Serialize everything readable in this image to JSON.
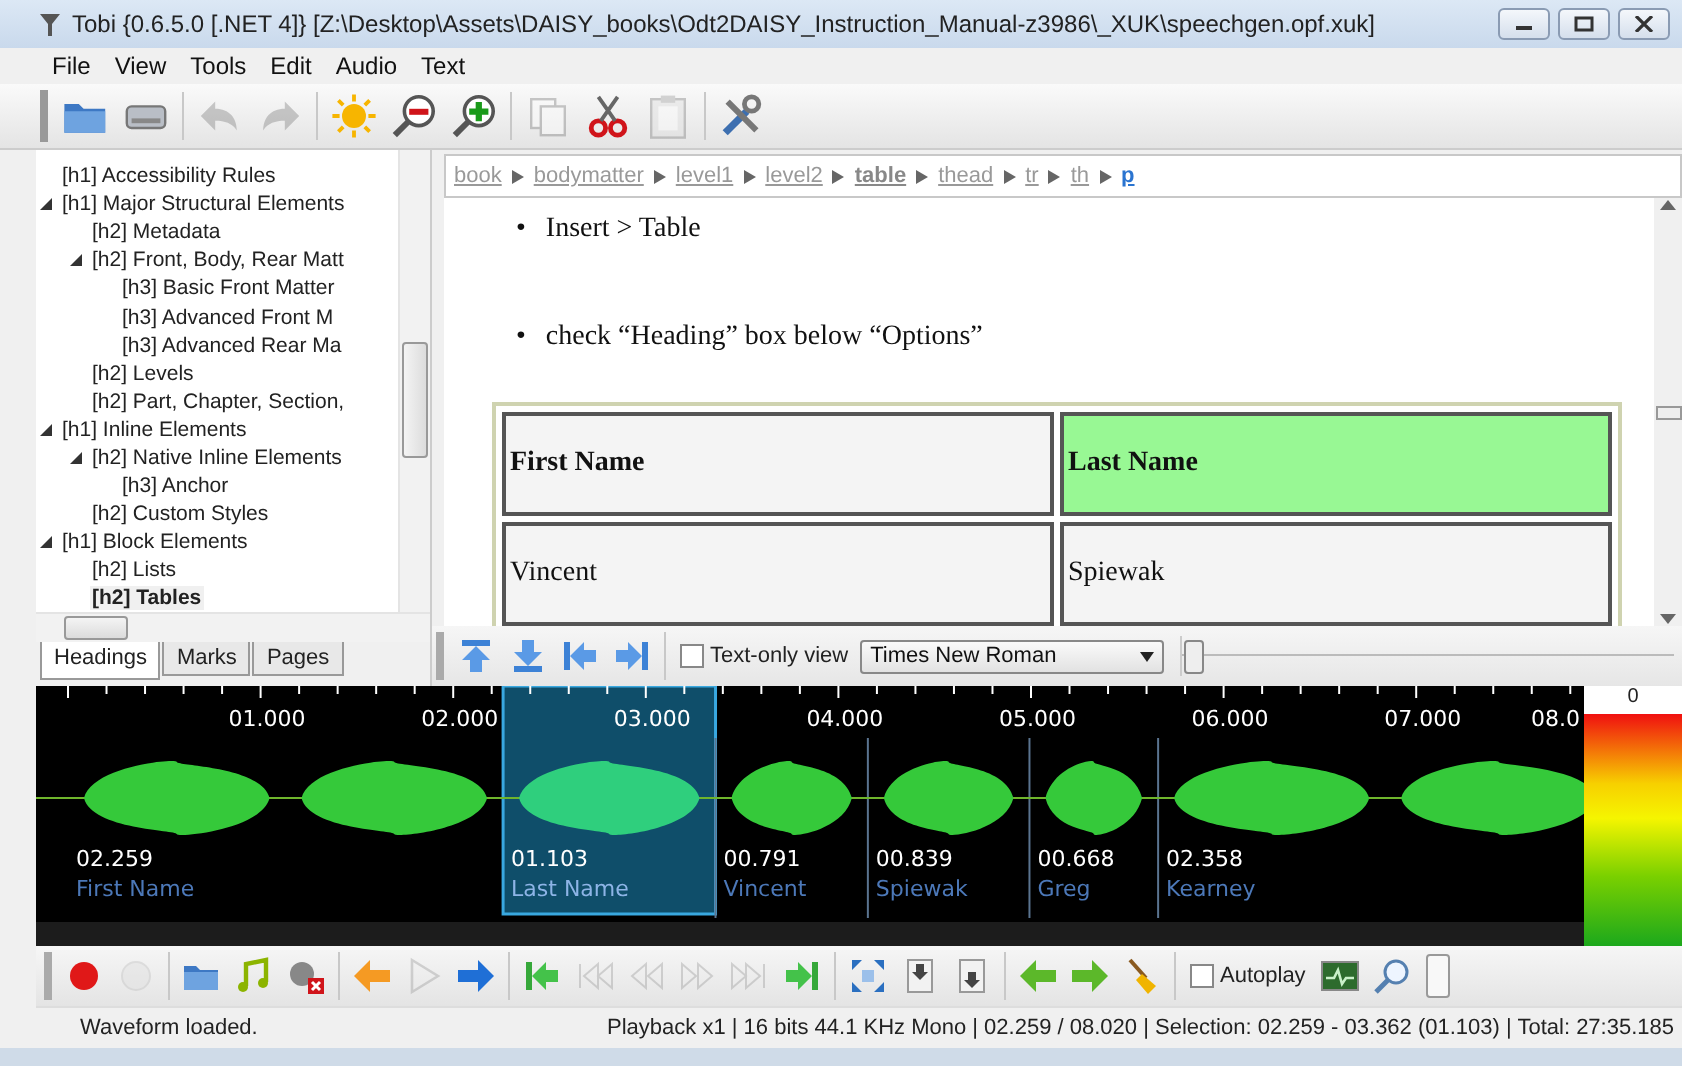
{
  "window": {
    "title": "Tobi {0.6.5.0 [.NET 4]} [Z:\\Desktop\\Assets\\DAISY_books\\Odt2DAISY_Instruction_Manual-z3986\\_XUK\\speechgen.opf.xuk]"
  },
  "menu": [
    "File",
    "View",
    "Tools",
    "Edit",
    "Audio",
    "Text"
  ],
  "toolbar": [
    {
      "disabled": false
    },
    {
      "disabled": false
    },
    {
      "disabled": true
    },
    {
      "disabled": true
    },
    {
      "disabled": false
    },
    {
      "disabled": false
    },
    {
      "disabled": false
    },
    {
      "disabled": true
    },
    {
      "disabled": false
    },
    {
      "disabled": true
    },
    {
      "disabled": false
    }
  ],
  "tree": [
    {
      "label": "[h1] Accessibility Rules",
      "selected": false
    },
    {
      "label": "[h1] Major Structural Elements",
      "selected": false,
      "expanded": true,
      "children": [
        {
          "label": "[h2] Metadata",
          "selected": false
        },
        {
          "label": "[h2] Front, Body, Rear Matt",
          "selected": false,
          "expanded": true,
          "children": [
            {
              "label": "[h3] Basic Front Matter",
              "selected": false
            },
            {
              "label": "[h3] Advanced Front M",
              "selected": false
            },
            {
              "label": "[h3] Advanced Rear Ma",
              "selected": false
            }
          ]
        },
        {
          "label": "[h2] Levels",
          "selected": false
        },
        {
          "label": "[h2] Part, Chapter, Section,",
          "selected": false
        }
      ]
    },
    {
      "label": "[h1] Inline Elements",
      "selected": false,
      "expanded": true,
      "children": [
        {
          "label": "[h2] Native Inline Elements",
          "selected": false,
          "expanded": true,
          "children": [
            {
              "label": "[h3] Anchor",
              "selected": false
            }
          ]
        },
        {
          "label": "[h2] Custom Styles",
          "selected": false
        }
      ]
    },
    {
      "label": "[h1] Block Elements",
      "selected": false,
      "expanded": true,
      "children": [
        {
          "label": "[h2] Lists",
          "selected": false
        },
        {
          "label": "[h2] Tables",
          "selected": true
        }
      ]
    }
  ],
  "tree_tabs": [
    {
      "label": "Headings",
      "selected": true
    },
    {
      "label": "Marks",
      "selected": false
    },
    {
      "label": "Pages",
      "selected": false
    }
  ],
  "breadcrumb": [
    {
      "label": "book",
      "strong": false,
      "selected": false
    },
    {
      "label": "bodymatter",
      "strong": false,
      "selected": false
    },
    {
      "label": "level1",
      "strong": false,
      "selected": false
    },
    {
      "label": "level2",
      "strong": false,
      "selected": false
    },
    {
      "label": "table",
      "strong": true,
      "selected": false
    },
    {
      "label": "thead",
      "strong": false,
      "selected": false
    },
    {
      "label": "tr",
      "strong": false,
      "selected": false
    },
    {
      "label": "th",
      "strong": false,
      "selected": false
    },
    {
      "label": "p",
      "strong": false,
      "selected": true
    }
  ],
  "document": {
    "bullets": [
      {
        "marker": "•",
        "text": "Insert > Table"
      },
      {
        "marker": "•",
        "text": "check “Heading” box below “Options”"
      }
    ],
    "table": {
      "header": [
        {
          "text": "First Name",
          "selected": false
        },
        {
          "text": "Last Name",
          "selected": true
        }
      ],
      "rows": [
        [
          "Vincent",
          "Spiewak"
        ]
      ]
    }
  },
  "doc_toolbar": {
    "text_only": {
      "label": "Text-only view",
      "checked": false
    },
    "font": "Times New Roman",
    "zoom": {
      "level": 0
    }
  },
  "waveform": {
    "ruler": [
      "01.000",
      "02.000",
      "03.000",
      "04.000",
      "05.000",
      "06.000",
      "07.000",
      "08.0"
    ],
    "segments": [
      {
        "duration": "02.259",
        "name": "First Name",
        "selected": false
      },
      {
        "duration": "01.103",
        "name": "Last Name",
        "selected": true
      },
      {
        "duration": "00.791",
        "name": "Vincent",
        "selected": false
      },
      {
        "duration": "00.839",
        "name": "Spiewak",
        "selected": false
      },
      {
        "duration": "00.668",
        "name": "Greg",
        "selected": false
      },
      {
        "duration": "02.358",
        "name": "Kearney",
        "selected": false
      }
    ],
    "meter_label": "0"
  },
  "audio_toolbar": {
    "buttons": [
      {
        "disabled": false
      },
      {
        "disabled": true
      },
      {
        "disabled": false
      },
      {
        "disabled": false
      },
      {
        "disabled": false
      },
      {
        "disabled": false
      },
      {
        "disabled": true
      },
      {
        "disabled": false
      },
      {
        "disabled": false
      },
      {
        "disabled": true
      },
      {
        "disabled": true
      },
      {
        "disabled": true
      },
      {
        "disabled": true
      },
      {
        "disabled": false
      },
      {
        "disabled": false
      },
      {
        "disabled": false
      },
      {
        "disabled": false
      },
      {
        "disabled": false
      },
      {
        "disabled": false
      },
      {
        "disabled": false
      }
    ],
    "autoplay": {
      "label": "Autoplay",
      "checked": false
    }
  },
  "status_bar": {
    "message": "Waveform loaded.",
    "info": "Playback x1 | 16 bits 44.1 KHz Mono | 02.259 / 08.020 | Selection: 02.259 - 03.362 (01.103) | Total: 27:35.185"
  }
}
